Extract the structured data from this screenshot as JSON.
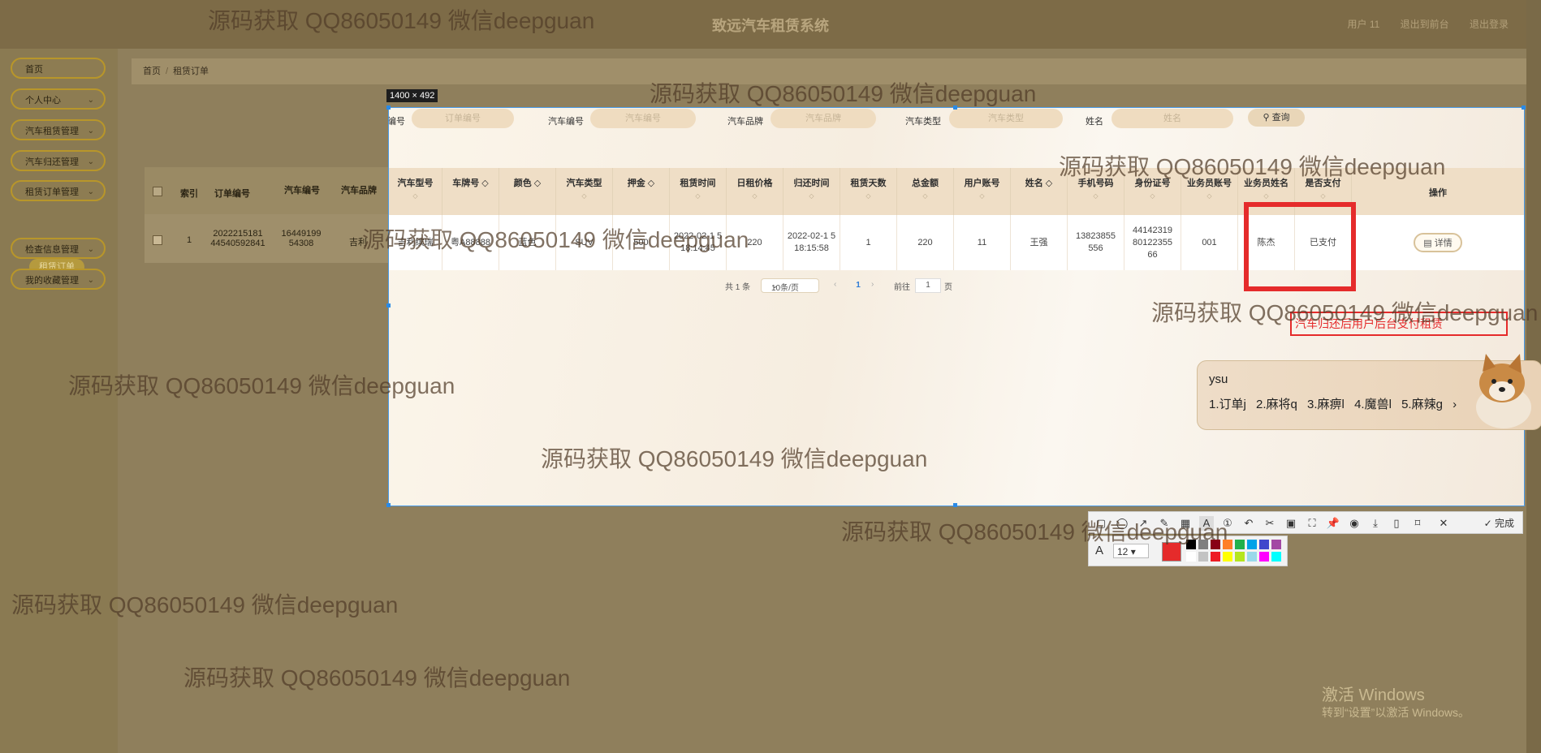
{
  "app": {
    "title": "致远汽车租赁系统",
    "top_links": [
      "用户 11",
      "退出到前台",
      "退出登录"
    ]
  },
  "sidebar": {
    "items": [
      "首页",
      "个人中心",
      "汽车租赁管理",
      "汽车归还管理",
      "租赁订单管理",
      "检查信息管理",
      "我的收藏管理"
    ],
    "active_sub": "租赁订单"
  },
  "breadcrumb": {
    "home": "首页",
    "current": "租赁订单"
  },
  "screenshot": {
    "size_label": "1400 × 492"
  },
  "search": {
    "fields": [
      {
        "label": "订单编号",
        "placeholder": "订单编号"
      },
      {
        "label": "汽车编号",
        "placeholder": "汽车编号"
      },
      {
        "label": "汽车品牌",
        "placeholder": "汽车品牌"
      },
      {
        "label": "汽车类型",
        "placeholder": "汽车类型"
      },
      {
        "label": "姓名",
        "placeholder": "姓名"
      }
    ],
    "button": "查询"
  },
  "table": {
    "columns": [
      "索引",
      "订单编号",
      "汽车编号",
      "汽车品牌",
      "汽车型号",
      "车牌号",
      "颜色",
      "汽车类型",
      "押金",
      "租赁时间",
      "日租价格",
      "归还时间",
      "租赁天数",
      "总金额",
      "用户账号",
      "姓名",
      "手机号码",
      "身份证号",
      "业务员账号",
      "业务员姓名",
      "是否支付",
      "操作"
    ],
    "row": {
      "index": "1",
      "order_no": "2022215181 44540592841",
      "car_no": "16449199 54308",
      "brand": "吉利",
      "model": "吉利缤瑞",
      "plate": "粤A88888",
      "color": "蓝色",
      "type": "SUV",
      "deposit": "500",
      "rent_time": "2022-02-1 5 18:14:45",
      "daily_price": "220",
      "return_time": "2022-02-1 5 18:15:58",
      "days": "1",
      "total": "220",
      "user_account": "11",
      "name": "王强",
      "phone": "13823855 556",
      "id_card": "44142319 80122355 66",
      "staff_account": "001",
      "staff_name": "陈杰",
      "paid": "已支付",
      "action": "详情"
    }
  },
  "pager": {
    "total": "共 1 条",
    "page_size": "10条/页",
    "current": "1",
    "goto_label": "前往",
    "goto_value": "1",
    "page_unit": "页"
  },
  "annotation": {
    "text": "汽车归还后用户后台支付租赁"
  },
  "ime": {
    "input": "ysu",
    "candidates": [
      "1.订单j",
      "2.麻将q",
      "3.麻痹l",
      "4.魔兽l",
      "5.麻辣g"
    ]
  },
  "toolbar": {
    "done": "完成",
    "font_size": "12"
  },
  "colors": {
    "accent_red": "#e52b2b",
    "selection_border": "#4a9be8",
    "palette": [
      "#000000",
      "#7f7f7f",
      "#880015",
      "#ff7f27",
      "#22b14c",
      "#00a2e8",
      "#3f48cc",
      "#a349a4",
      "#ffffff",
      "#c3c3c3",
      "#ed1c24",
      "#ffff00",
      "#b5e61d",
      "#99d9ea",
      "#ff00ff",
      "#00ffff"
    ]
  },
  "watermark": "源码获取 QQ86050149 微信deepguan",
  "windows": {
    "activate": "激活 Windows",
    "activate_sub": "转到“设置”以激活 Windows。"
  }
}
